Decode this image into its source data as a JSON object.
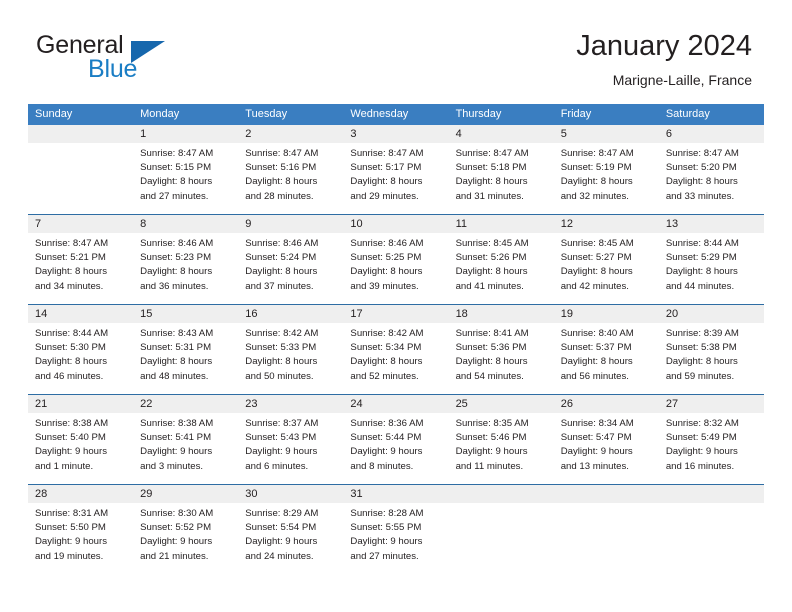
{
  "brand": {
    "name_part1": "General",
    "name_part2": "Blue",
    "logo_icon": "triangle-logo-icon"
  },
  "header": {
    "title": "January 2024",
    "subtitle": "Marigne-Laille, France"
  },
  "calendar": {
    "weekday_headers": [
      "Sunday",
      "Monday",
      "Tuesday",
      "Wednesday",
      "Thursday",
      "Friday",
      "Saturday"
    ],
    "accent_color": "#3a7ec1",
    "separator_color": "#2e6da4",
    "number_band_color": "#efefef",
    "weeks": [
      {
        "days": [
          {
            "number": "",
            "lines": []
          },
          {
            "number": "1",
            "lines": [
              "Sunrise: 8:47 AM",
              "Sunset: 5:15 PM",
              "Daylight: 8 hours",
              "and 27 minutes."
            ]
          },
          {
            "number": "2",
            "lines": [
              "Sunrise: 8:47 AM",
              "Sunset: 5:16 PM",
              "Daylight: 8 hours",
              "and 28 minutes."
            ]
          },
          {
            "number": "3",
            "lines": [
              "Sunrise: 8:47 AM",
              "Sunset: 5:17 PM",
              "Daylight: 8 hours",
              "and 29 minutes."
            ]
          },
          {
            "number": "4",
            "lines": [
              "Sunrise: 8:47 AM",
              "Sunset: 5:18 PM",
              "Daylight: 8 hours",
              "and 31 minutes."
            ]
          },
          {
            "number": "5",
            "lines": [
              "Sunrise: 8:47 AM",
              "Sunset: 5:19 PM",
              "Daylight: 8 hours",
              "and 32 minutes."
            ]
          },
          {
            "number": "6",
            "lines": [
              "Sunrise: 8:47 AM",
              "Sunset: 5:20 PM",
              "Daylight: 8 hours",
              "and 33 minutes."
            ]
          }
        ]
      },
      {
        "days": [
          {
            "number": "7",
            "lines": [
              "Sunrise: 8:47 AM",
              "Sunset: 5:21 PM",
              "Daylight: 8 hours",
              "and 34 minutes."
            ]
          },
          {
            "number": "8",
            "lines": [
              "Sunrise: 8:46 AM",
              "Sunset: 5:23 PM",
              "Daylight: 8 hours",
              "and 36 minutes."
            ]
          },
          {
            "number": "9",
            "lines": [
              "Sunrise: 8:46 AM",
              "Sunset: 5:24 PM",
              "Daylight: 8 hours",
              "and 37 minutes."
            ]
          },
          {
            "number": "10",
            "lines": [
              "Sunrise: 8:46 AM",
              "Sunset: 5:25 PM",
              "Daylight: 8 hours",
              "and 39 minutes."
            ]
          },
          {
            "number": "11",
            "lines": [
              "Sunrise: 8:45 AM",
              "Sunset: 5:26 PM",
              "Daylight: 8 hours",
              "and 41 minutes."
            ]
          },
          {
            "number": "12",
            "lines": [
              "Sunrise: 8:45 AM",
              "Sunset: 5:27 PM",
              "Daylight: 8 hours",
              "and 42 minutes."
            ]
          },
          {
            "number": "13",
            "lines": [
              "Sunrise: 8:44 AM",
              "Sunset: 5:29 PM",
              "Daylight: 8 hours",
              "and 44 minutes."
            ]
          }
        ]
      },
      {
        "days": [
          {
            "number": "14",
            "lines": [
              "Sunrise: 8:44 AM",
              "Sunset: 5:30 PM",
              "Daylight: 8 hours",
              "and 46 minutes."
            ]
          },
          {
            "number": "15",
            "lines": [
              "Sunrise: 8:43 AM",
              "Sunset: 5:31 PM",
              "Daylight: 8 hours",
              "and 48 minutes."
            ]
          },
          {
            "number": "16",
            "lines": [
              "Sunrise: 8:42 AM",
              "Sunset: 5:33 PM",
              "Daylight: 8 hours",
              "and 50 minutes."
            ]
          },
          {
            "number": "17",
            "lines": [
              "Sunrise: 8:42 AM",
              "Sunset: 5:34 PM",
              "Daylight: 8 hours",
              "and 52 minutes."
            ]
          },
          {
            "number": "18",
            "lines": [
              "Sunrise: 8:41 AM",
              "Sunset: 5:36 PM",
              "Daylight: 8 hours",
              "and 54 minutes."
            ]
          },
          {
            "number": "19",
            "lines": [
              "Sunrise: 8:40 AM",
              "Sunset: 5:37 PM",
              "Daylight: 8 hours",
              "and 56 minutes."
            ]
          },
          {
            "number": "20",
            "lines": [
              "Sunrise: 8:39 AM",
              "Sunset: 5:38 PM",
              "Daylight: 8 hours",
              "and 59 minutes."
            ]
          }
        ]
      },
      {
        "days": [
          {
            "number": "21",
            "lines": [
              "Sunrise: 8:38 AM",
              "Sunset: 5:40 PM",
              "Daylight: 9 hours",
              "and 1 minute."
            ]
          },
          {
            "number": "22",
            "lines": [
              "Sunrise: 8:38 AM",
              "Sunset: 5:41 PM",
              "Daylight: 9 hours",
              "and 3 minutes."
            ]
          },
          {
            "number": "23",
            "lines": [
              "Sunrise: 8:37 AM",
              "Sunset: 5:43 PM",
              "Daylight: 9 hours",
              "and 6 minutes."
            ]
          },
          {
            "number": "24",
            "lines": [
              "Sunrise: 8:36 AM",
              "Sunset: 5:44 PM",
              "Daylight: 9 hours",
              "and 8 minutes."
            ]
          },
          {
            "number": "25",
            "lines": [
              "Sunrise: 8:35 AM",
              "Sunset: 5:46 PM",
              "Daylight: 9 hours",
              "and 11 minutes."
            ]
          },
          {
            "number": "26",
            "lines": [
              "Sunrise: 8:34 AM",
              "Sunset: 5:47 PM",
              "Daylight: 9 hours",
              "and 13 minutes."
            ]
          },
          {
            "number": "27",
            "lines": [
              "Sunrise: 8:32 AM",
              "Sunset: 5:49 PM",
              "Daylight: 9 hours",
              "and 16 minutes."
            ]
          }
        ]
      },
      {
        "days": [
          {
            "number": "28",
            "lines": [
              "Sunrise: 8:31 AM",
              "Sunset: 5:50 PM",
              "Daylight: 9 hours",
              "and 19 minutes."
            ]
          },
          {
            "number": "29",
            "lines": [
              "Sunrise: 8:30 AM",
              "Sunset: 5:52 PM",
              "Daylight: 9 hours",
              "and 21 minutes."
            ]
          },
          {
            "number": "30",
            "lines": [
              "Sunrise: 8:29 AM",
              "Sunset: 5:54 PM",
              "Daylight: 9 hours",
              "and 24 minutes."
            ]
          },
          {
            "number": "31",
            "lines": [
              "Sunrise: 8:28 AM",
              "Sunset: 5:55 PM",
              "Daylight: 9 hours",
              "and 27 minutes."
            ]
          },
          {
            "number": "",
            "lines": []
          },
          {
            "number": "",
            "lines": []
          },
          {
            "number": "",
            "lines": []
          }
        ]
      }
    ]
  }
}
